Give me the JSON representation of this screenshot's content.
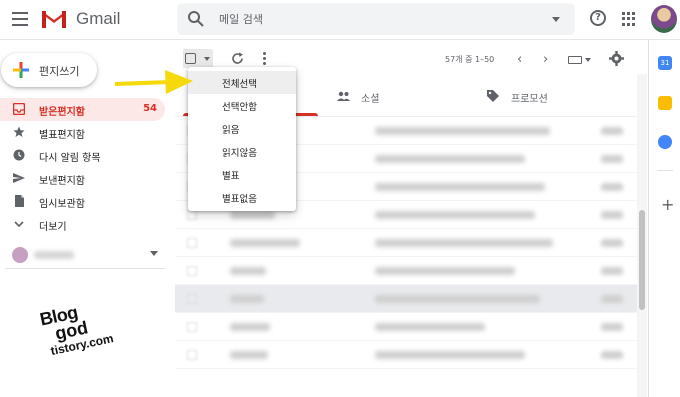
{
  "header": {
    "app_name": "Gmail",
    "search_placeholder": "메일 검색"
  },
  "compose": {
    "label": "편지쓰기"
  },
  "sidebar": {
    "items": [
      {
        "label": "받은편지함",
        "count": "54",
        "icon": "inbox-icon",
        "active": true
      },
      {
        "label": "별표편지함",
        "count": "",
        "icon": "star-icon"
      },
      {
        "label": "다시 알림 항목",
        "count": "",
        "icon": "clock-icon"
      },
      {
        "label": "보낸편지함",
        "count": "",
        "icon": "send-icon"
      },
      {
        "label": "임시보관함",
        "count": "",
        "icon": "draft-icon"
      },
      {
        "label": "더보기",
        "count": "",
        "icon": "chevron-down-icon"
      }
    ]
  },
  "toolbar": {
    "pager_text": "57개 중 1–50",
    "prev_icon": "chevron-left-icon",
    "next_icon": "chevron-right-icon"
  },
  "tabs": [
    {
      "label": "",
      "icon": "inbox-tab-icon"
    },
    {
      "label": "소셜",
      "icon": "people-icon"
    },
    {
      "label": "프로모션",
      "icon": "tag-icon"
    }
  ],
  "select_menu": {
    "items": [
      {
        "label": "전체선택",
        "highlighted": true
      },
      {
        "label": "선택안함"
      },
      {
        "label": "읽음"
      },
      {
        "label": "읽지않음"
      },
      {
        "label": "별표"
      },
      {
        "label": "별표없음"
      }
    ]
  },
  "right_panel": {
    "calendar_label": "31"
  },
  "watermark": {
    "line1": "Blog",
    "line2": "god",
    "line3": "tistory.com"
  },
  "colors": {
    "gmail_red": "#d93025",
    "active_bg": "#fce8e6",
    "arrow_yellow": "#f5d90a"
  }
}
